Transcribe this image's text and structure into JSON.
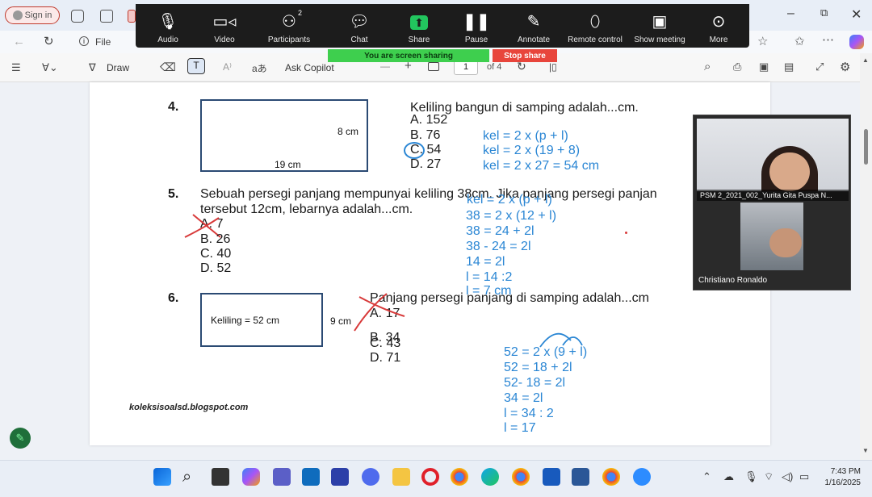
{
  "browser": {
    "signin_label": "Sign in",
    "file_label": "File",
    "info_icon": "info-icon"
  },
  "zoom": {
    "participants_count": "2",
    "items": [
      {
        "label": "Audio",
        "icon": "microphone-icon"
      },
      {
        "label": "Video",
        "icon": "camera-icon"
      },
      {
        "label": "Participants",
        "icon": "people-icon"
      },
      {
        "label": "Chat",
        "icon": "chat-icon"
      },
      {
        "label": "Share",
        "icon": "share-icon"
      },
      {
        "label": "Pause",
        "icon": "pause-icon"
      },
      {
        "label": "Annotate",
        "icon": "pen-icon"
      },
      {
        "label": "Remote control",
        "icon": "mouse-icon"
      },
      {
        "label": "Show meeting",
        "icon": "window-icon"
      },
      {
        "label": "More",
        "icon": "more-icon"
      }
    ],
    "sharing_text": "You are screen sharing",
    "stop_share_label": "Stop share",
    "colors": {
      "bar": "#1c1c1c",
      "sharing": "#3ecf4e",
      "stop": "#e8453c",
      "share_icon": "#22c55e"
    }
  },
  "pdf_toolbar": {
    "draw_label": "Draw",
    "ask_copilot_label": "Ask Copilot",
    "page_input": "1",
    "page_total": "of 4",
    "minus": "—",
    "plus": "+"
  },
  "document": {
    "q4": {
      "num": "4.",
      "text": "Keliling bangun di samping adalah...cm.",
      "height_label": "8 cm",
      "width_label": "19 cm",
      "options": [
        "A.  152",
        "B.  76",
        "C.  54",
        "D.  27"
      ],
      "work": [
        "kel = 2 x (p + l)",
        "kel = 2 x (19 + 8)",
        "kel = 2 x 27 = 54 cm"
      ]
    },
    "q5": {
      "num": "5.",
      "text_line1": "Sebuah persegi panjang mempunyai keliling 38cm. Jika panjang persegi panjan",
      "text_line2": "tersebut 12cm, lebarnya adalah...cm.",
      "options": [
        "A.  7",
        "B.  26",
        "C.  40",
        "D.  52"
      ],
      "work": [
        "kel = 2 x (p + l)",
        "38 = 2 x (12 + l)",
        "38 = 24 + 2l",
        "38 - 24 = 2l",
        "14 = 2l",
        "l = 14 :2",
        "l = 7 cm"
      ]
    },
    "q6": {
      "num": "6.",
      "text": "Panjang persegi panjang di samping adalah...cm",
      "keliling_label": "Keliling = 52 cm",
      "height_label": "9 cm",
      "options": [
        "A.  17",
        "B.  34",
        "C.  43",
        "D.  71"
      ],
      "work": [
        "52 = 2 x (9 + l)",
        "52 = 18 + 2l",
        "52- 18 = 2l",
        "34 = 2l",
        "l = 34 : 2",
        "l = 17"
      ]
    },
    "footer": "koleksisoalsd.blogspot.com",
    "colors": {
      "ink": "#2a86d4",
      "mark": "#d83a3a",
      "rect": "#2b4a73"
    }
  },
  "video": {
    "participant1": "PSM 2_2021_002_Yurita Gita Puspa N...",
    "participant2": "Christiano Ronaldo"
  },
  "taskbar": {
    "time": "7:43 PM",
    "date": "1/16/2025"
  }
}
